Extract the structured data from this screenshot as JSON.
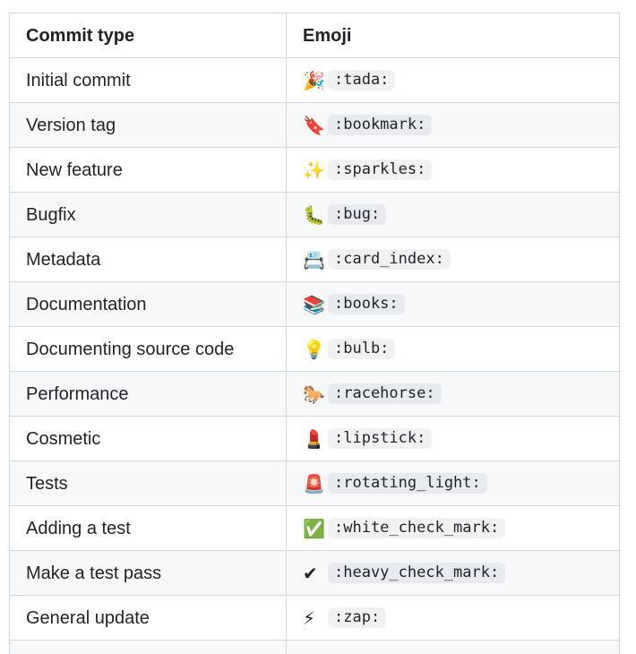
{
  "table": {
    "headers": {
      "commit_type": "Commit type",
      "emoji": "Emoji"
    },
    "rows": [
      {
        "type": "Initial commit",
        "glyph": "🎉",
        "code": ":tada:",
        "icon": "party-popper-icon"
      },
      {
        "type": "Version tag",
        "glyph": "🔖",
        "code": ":bookmark:",
        "icon": "bookmark-tag-icon"
      },
      {
        "type": "New feature",
        "glyph": "✨",
        "code": ":sparkles:",
        "icon": "sparkles-icon"
      },
      {
        "type": "Bugfix",
        "glyph": "🐛",
        "code": ":bug:",
        "icon": "bug-icon"
      },
      {
        "type": "Metadata",
        "glyph": "📇",
        "code": ":card_index:",
        "icon": "card-index-icon"
      },
      {
        "type": "Documentation",
        "glyph": "📚",
        "code": ":books:",
        "icon": "books-icon"
      },
      {
        "type": "Documenting source code",
        "glyph": "💡",
        "code": ":bulb:",
        "icon": "light-bulb-icon"
      },
      {
        "type": "Performance",
        "glyph": "🐎",
        "code": ":racehorse:",
        "icon": "racehorse-icon"
      },
      {
        "type": "Cosmetic",
        "glyph": "💄",
        "code": ":lipstick:",
        "icon": "lipstick-icon"
      },
      {
        "type": "Tests",
        "glyph": "🚨",
        "code": ":rotating_light:",
        "icon": "rotating-light-icon"
      },
      {
        "type": "Adding a test",
        "glyph": "✅",
        "code": ":white_check_mark:",
        "icon": "white-check-mark-icon"
      },
      {
        "type": "Make a test pass",
        "glyph": "✔",
        "code": ":heavy_check_mark:",
        "icon": "heavy-check-mark-icon"
      },
      {
        "type": "General update",
        "glyph": "⚡",
        "code": ":zap:",
        "icon": "zap-icon"
      }
    ]
  },
  "colors": {
    "border": "#d0d7de",
    "stripe": "#f6f8fa",
    "text": "#1f2328",
    "code_bg": "#eff1f3"
  }
}
